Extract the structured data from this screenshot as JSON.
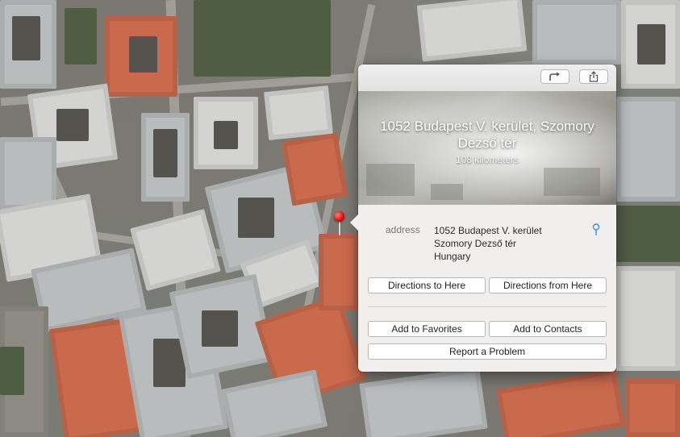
{
  "map": {
    "pin_icon": "red-location-pin"
  },
  "toolbar": {
    "directions_icon": "turn-arrow-icon",
    "share_icon": "share-icon"
  },
  "place": {
    "title": "1052 Budapest V. kerület, Szomory Dezső tér",
    "distance": "108 kilometers"
  },
  "info": {
    "label": "address",
    "address_lines": [
      "1052 Budapest V. kerület",
      "Szomory Dezső tér",
      "Hungary"
    ],
    "locate_icon": "map-pin-icon"
  },
  "buttons": {
    "directions_to_here": "Directions to Here",
    "directions_from_here": "Directions from Here",
    "add_to_favorites": "Add to Favorites",
    "add_to_contacts": "Add to Contacts",
    "report_problem": "Report a Problem"
  },
  "colors": {
    "popover_bg": "#f1efee",
    "pin_red": "#d70f0f",
    "accent_blue": "#3a8ee6"
  }
}
